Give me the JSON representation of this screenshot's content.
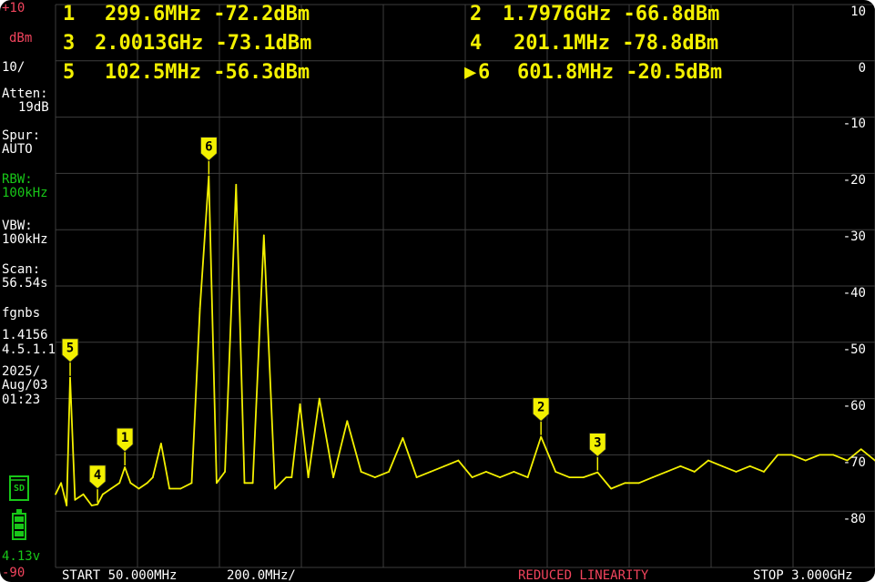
{
  "top_left": {
    "ref_level": "+10",
    "unit": "dBm",
    "scale": "10/"
  },
  "readouts": [
    {
      "index": "1",
      "text": "299.6MHz -72.2dBm"
    },
    {
      "index": "2",
      "text": "1.7976GHz -66.8dBm"
    },
    {
      "index": "3",
      "text": "2.0013GHz -73.1dBm"
    },
    {
      "index": "4",
      "text": "201.1MHz -78.8dBm"
    },
    {
      "index": "5",
      "text": "102.5MHz -56.3dBm"
    },
    {
      "index": "6",
      "text": "601.8MHz -20.5dBm",
      "active": true
    }
  ],
  "left_panel": {
    "atten_label": "Atten:",
    "atten_value": "19dB",
    "spur_label": "Spur:",
    "spur_value": "AUTO",
    "rbw_label": "RBW:",
    "rbw_value": "100kHz",
    "vbw_label": "VBW:",
    "vbw_value": "100kHz",
    "scan_label": "Scan:",
    "scan_value": "56.54s",
    "fw1": "fgnbs",
    "fw2": "1.4156",
    "fw3": "4.5.1.1",
    "date1": "2025/",
    "date2": "Aug/03",
    "time": "01:23",
    "battery_voltage": "4.13v",
    "bottom_ref": "-90"
  },
  "right_axis": {
    "labels": [
      "10",
      "0",
      "-10",
      "-20",
      "-30",
      "-40",
      "-50",
      "-60",
      "-70",
      "-80"
    ]
  },
  "bottom_bar": {
    "start": "START 50.000MHz",
    "span_per_div": "200.0MHz/",
    "warning": "REDUCED LINEARITY",
    "stop": "STOP 3.000GHz"
  },
  "icons": {
    "sd_card": "sd-card-icon",
    "battery": "battery-icon",
    "active_marker": "play-marker-icon"
  },
  "colors": {
    "trace": "#f3f000",
    "grid": "#3d3d3d",
    "warning": "#f2445d",
    "green": "#18c718",
    "ref_red": "#f2445d"
  },
  "chart_data": {
    "type": "line",
    "title": "",
    "xlabel": "",
    "ylabel": "",
    "xlim": [
      50,
      3000
    ],
    "ylim": [
      -90,
      10
    ],
    "grid": true,
    "series": [
      {
        "x": [
          50,
          70,
          90,
          102.5,
          120,
          150,
          180,
          201.1,
          220,
          250,
          280,
          299.6,
          320,
          350,
          380,
          400,
          430,
          460,
          500,
          540,
          570,
          601.8,
          630,
          660,
          700,
          730,
          760,
          800,
          840,
          880,
          900,
          930,
          960,
          1000,
          1050,
          1100,
          1150,
          1200,
          1250,
          1300,
          1350,
          1400,
          1450,
          1500,
          1550,
          1600,
          1650,
          1700,
          1750,
          1797.6,
          1850,
          1900,
          1950,
          2001.3,
          2050,
          2100,
          2150,
          2200,
          2250,
          2300,
          2350,
          2400,
          2450,
          2500,
          2550,
          2600,
          2650,
          2700,
          2750,
          2800,
          2850,
          2900,
          2950,
          3000
        ],
        "y": [
          -77,
          -75,
          -79,
          -56.3,
          -78,
          -77,
          -79,
          -78.8,
          -77,
          -76,
          -75,
          -72.2,
          -75,
          -76,
          -75,
          -74,
          -68,
          -76,
          -76,
          -75,
          -44,
          -20.5,
          -75,
          -73,
          -22,
          -75,
          -75,
          -31,
          -76,
          -74,
          -74,
          -61,
          -74,
          -60,
          -74,
          -64,
          -73,
          -74,
          -73,
          -67,
          -74,
          -73,
          -72,
          -71,
          -74,
          -73,
          -74,
          -73,
          -74,
          -66.8,
          -73,
          -74,
          -74,
          -73.1,
          -76,
          -75,
          -75,
          -74,
          -73,
          -72,
          -73,
          -71,
          -72,
          -73,
          -72,
          -73,
          -70,
          -70,
          -71,
          -70,
          -70,
          -71,
          -69,
          -71
        ]
      }
    ],
    "markers": [
      {
        "id": "1",
        "x": 299.6,
        "y": -72.2
      },
      {
        "id": "2",
        "x": 1797.6,
        "y": -66.8
      },
      {
        "id": "3",
        "x": 2001.3,
        "y": -73.1
      },
      {
        "id": "4",
        "x": 201.1,
        "y": -78.8
      },
      {
        "id": "5",
        "x": 102.5,
        "y": -56.3
      },
      {
        "id": "6",
        "x": 601.8,
        "y": -20.5
      }
    ]
  }
}
